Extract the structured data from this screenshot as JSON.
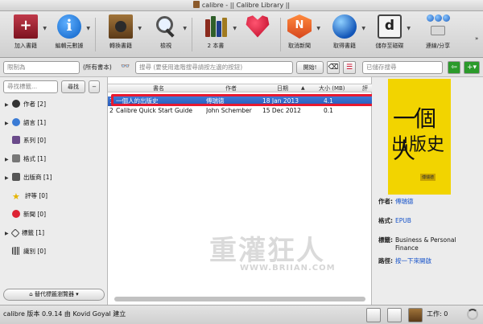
{
  "window": {
    "title": "calibre - || Calibre Library ||"
  },
  "toolbar": {
    "buttons": [
      {
        "label": "加入書籍"
      },
      {
        "label": "編輯元數據"
      },
      {
        "label": "轉換書籍"
      },
      {
        "label": "檢視"
      },
      {
        "label": "2 本書"
      },
      {
        "label": ""
      },
      {
        "label": "取消新聞"
      },
      {
        "label": "取得書籍"
      },
      {
        "label": "儲存至磁碟"
      },
      {
        "label": "連線/分享"
      }
    ]
  },
  "searchbar": {
    "restrict_placeholder": "限制為",
    "all_books_label": "(所有書本)",
    "search_placeholder": "搜尋 (要使用進階搜尋請按左邊的按鈕)",
    "go_button": "開始!",
    "saved_search_placeholder": "已儲存搜尋"
  },
  "tag_browser": {
    "find_placeholder": "尋找標籤...",
    "find_button": "尋找",
    "items": [
      {
        "label": "作者 [2]",
        "expanded": false
      },
      {
        "label": "語言 [1]",
        "expanded": false
      },
      {
        "label": "系列 [0]",
        "expanded": false
      },
      {
        "label": "格式 [1]",
        "expanded": false
      },
      {
        "label": "出版商 [1]",
        "expanded": false
      },
      {
        "label": "評等 [0]",
        "expanded": false
      },
      {
        "label": "新聞 [0]",
        "expanded": false
      },
      {
        "label": "標籤 [1]",
        "expanded": false
      },
      {
        "label": "識別 [0]",
        "expanded": false
      }
    ],
    "alt_browser_button": "替代標籤瀏覽器"
  },
  "book_table": {
    "columns": [
      "書名",
      "作者",
      "日期",
      "大小 (MB)",
      "評"
    ],
    "rows": [
      {
        "num": "1",
        "title": "一個人的出版史",
        "author": "傅瑞德",
        "date": "18 Jan 2013",
        "size": "4.1",
        "selected": true
      },
      {
        "num": "2",
        "title": "Calibre Quick Start Guide",
        "author": "John Schember",
        "date": "15 Dec 2012",
        "size": "0.1",
        "selected": false
      }
    ]
  },
  "book_details": {
    "cover_title_line1": "一個人",
    "cover_title_line2": "出版史",
    "author_label": "作者:",
    "author_value": "傅瑞德",
    "format_label": "格式:",
    "format_value": "EPUB",
    "tags_label": "標籤:",
    "tags_value": "Business & Personal Finance",
    "path_label": "路徑:",
    "path_value": "按一下來開啟"
  },
  "statusbar": {
    "message": "calibre 版本 0.9.14 由 Kovid Goyal 建立",
    "jobs_label": "工作:",
    "jobs_count": "0"
  },
  "watermark": {
    "line1": "重灌狂人",
    "line2": "WWW.BRIIAN.COM"
  },
  "colors": {
    "selection": "#2f66c8",
    "highlight_box": "#e8192f",
    "cover_bg": "#f2d400"
  }
}
